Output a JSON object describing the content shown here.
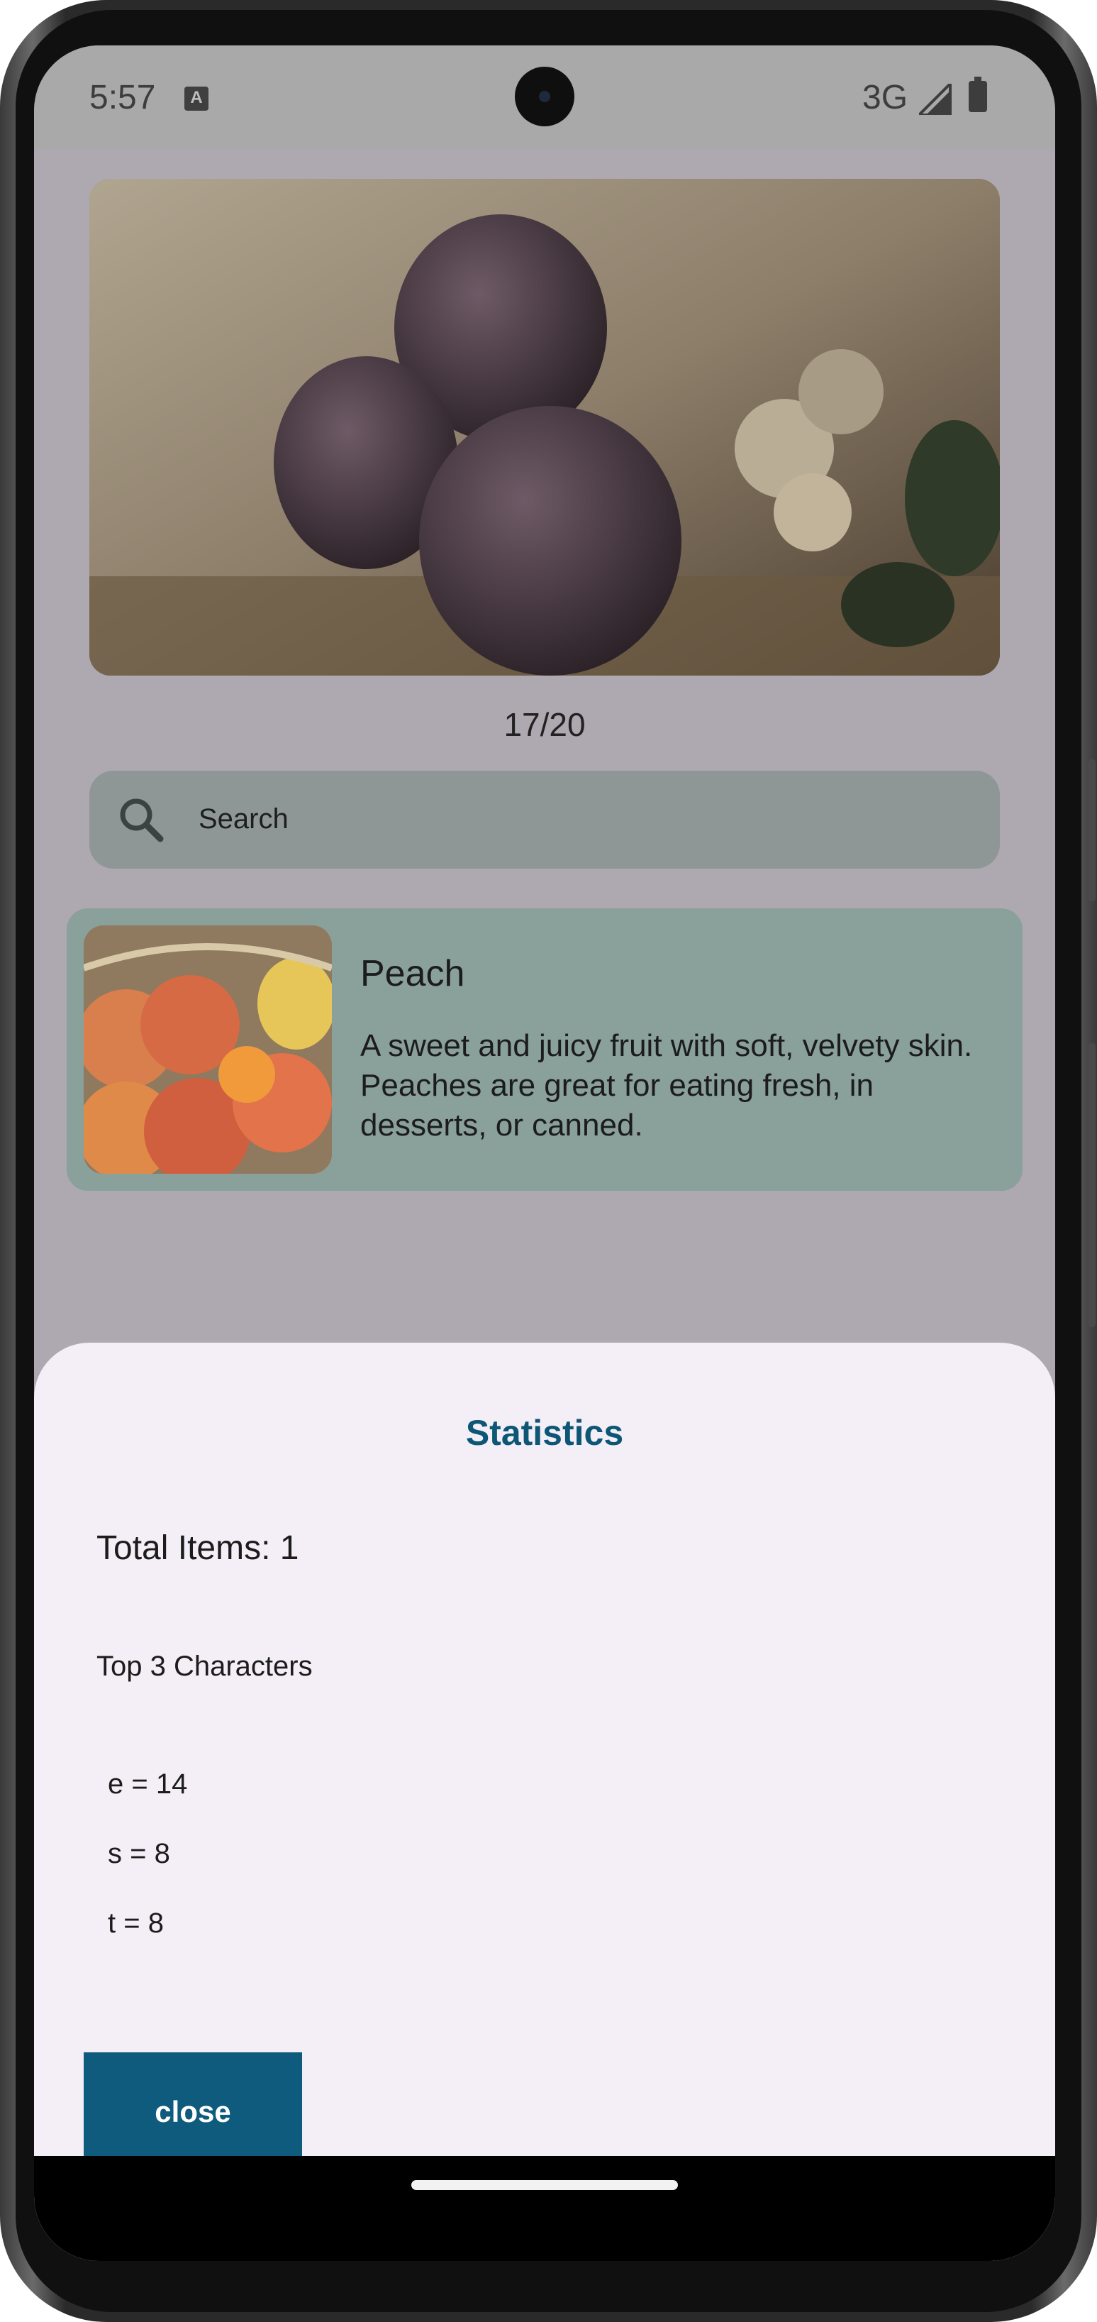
{
  "status_bar": {
    "time": "5:57",
    "notification_icon": "A",
    "network": "3G",
    "signal_icon": "signal-icon",
    "battery_icon": "battery-icon"
  },
  "hero_image": {
    "subject": "figs"
  },
  "counter": "17/20",
  "search": {
    "placeholder": "Search",
    "icon": "search-icon"
  },
  "result_card": {
    "title": "Peach",
    "description": "A sweet and juicy fruit with soft, velvety skin. Peaches are great for eating fresh, in desserts, or canned."
  },
  "statistics_sheet": {
    "heading": "Statistics",
    "total_items": "Total Items: 1",
    "top_label": "Top 3 Characters",
    "top_characters": [
      "e = 14",
      "s = 8",
      "t = 8"
    ],
    "close_label": "close"
  },
  "colors": {
    "accent": "#0f5b7d",
    "sheet_bg": "#f4eff7",
    "scrim": "#aea8b0",
    "card_bg": "#8aa09a"
  }
}
